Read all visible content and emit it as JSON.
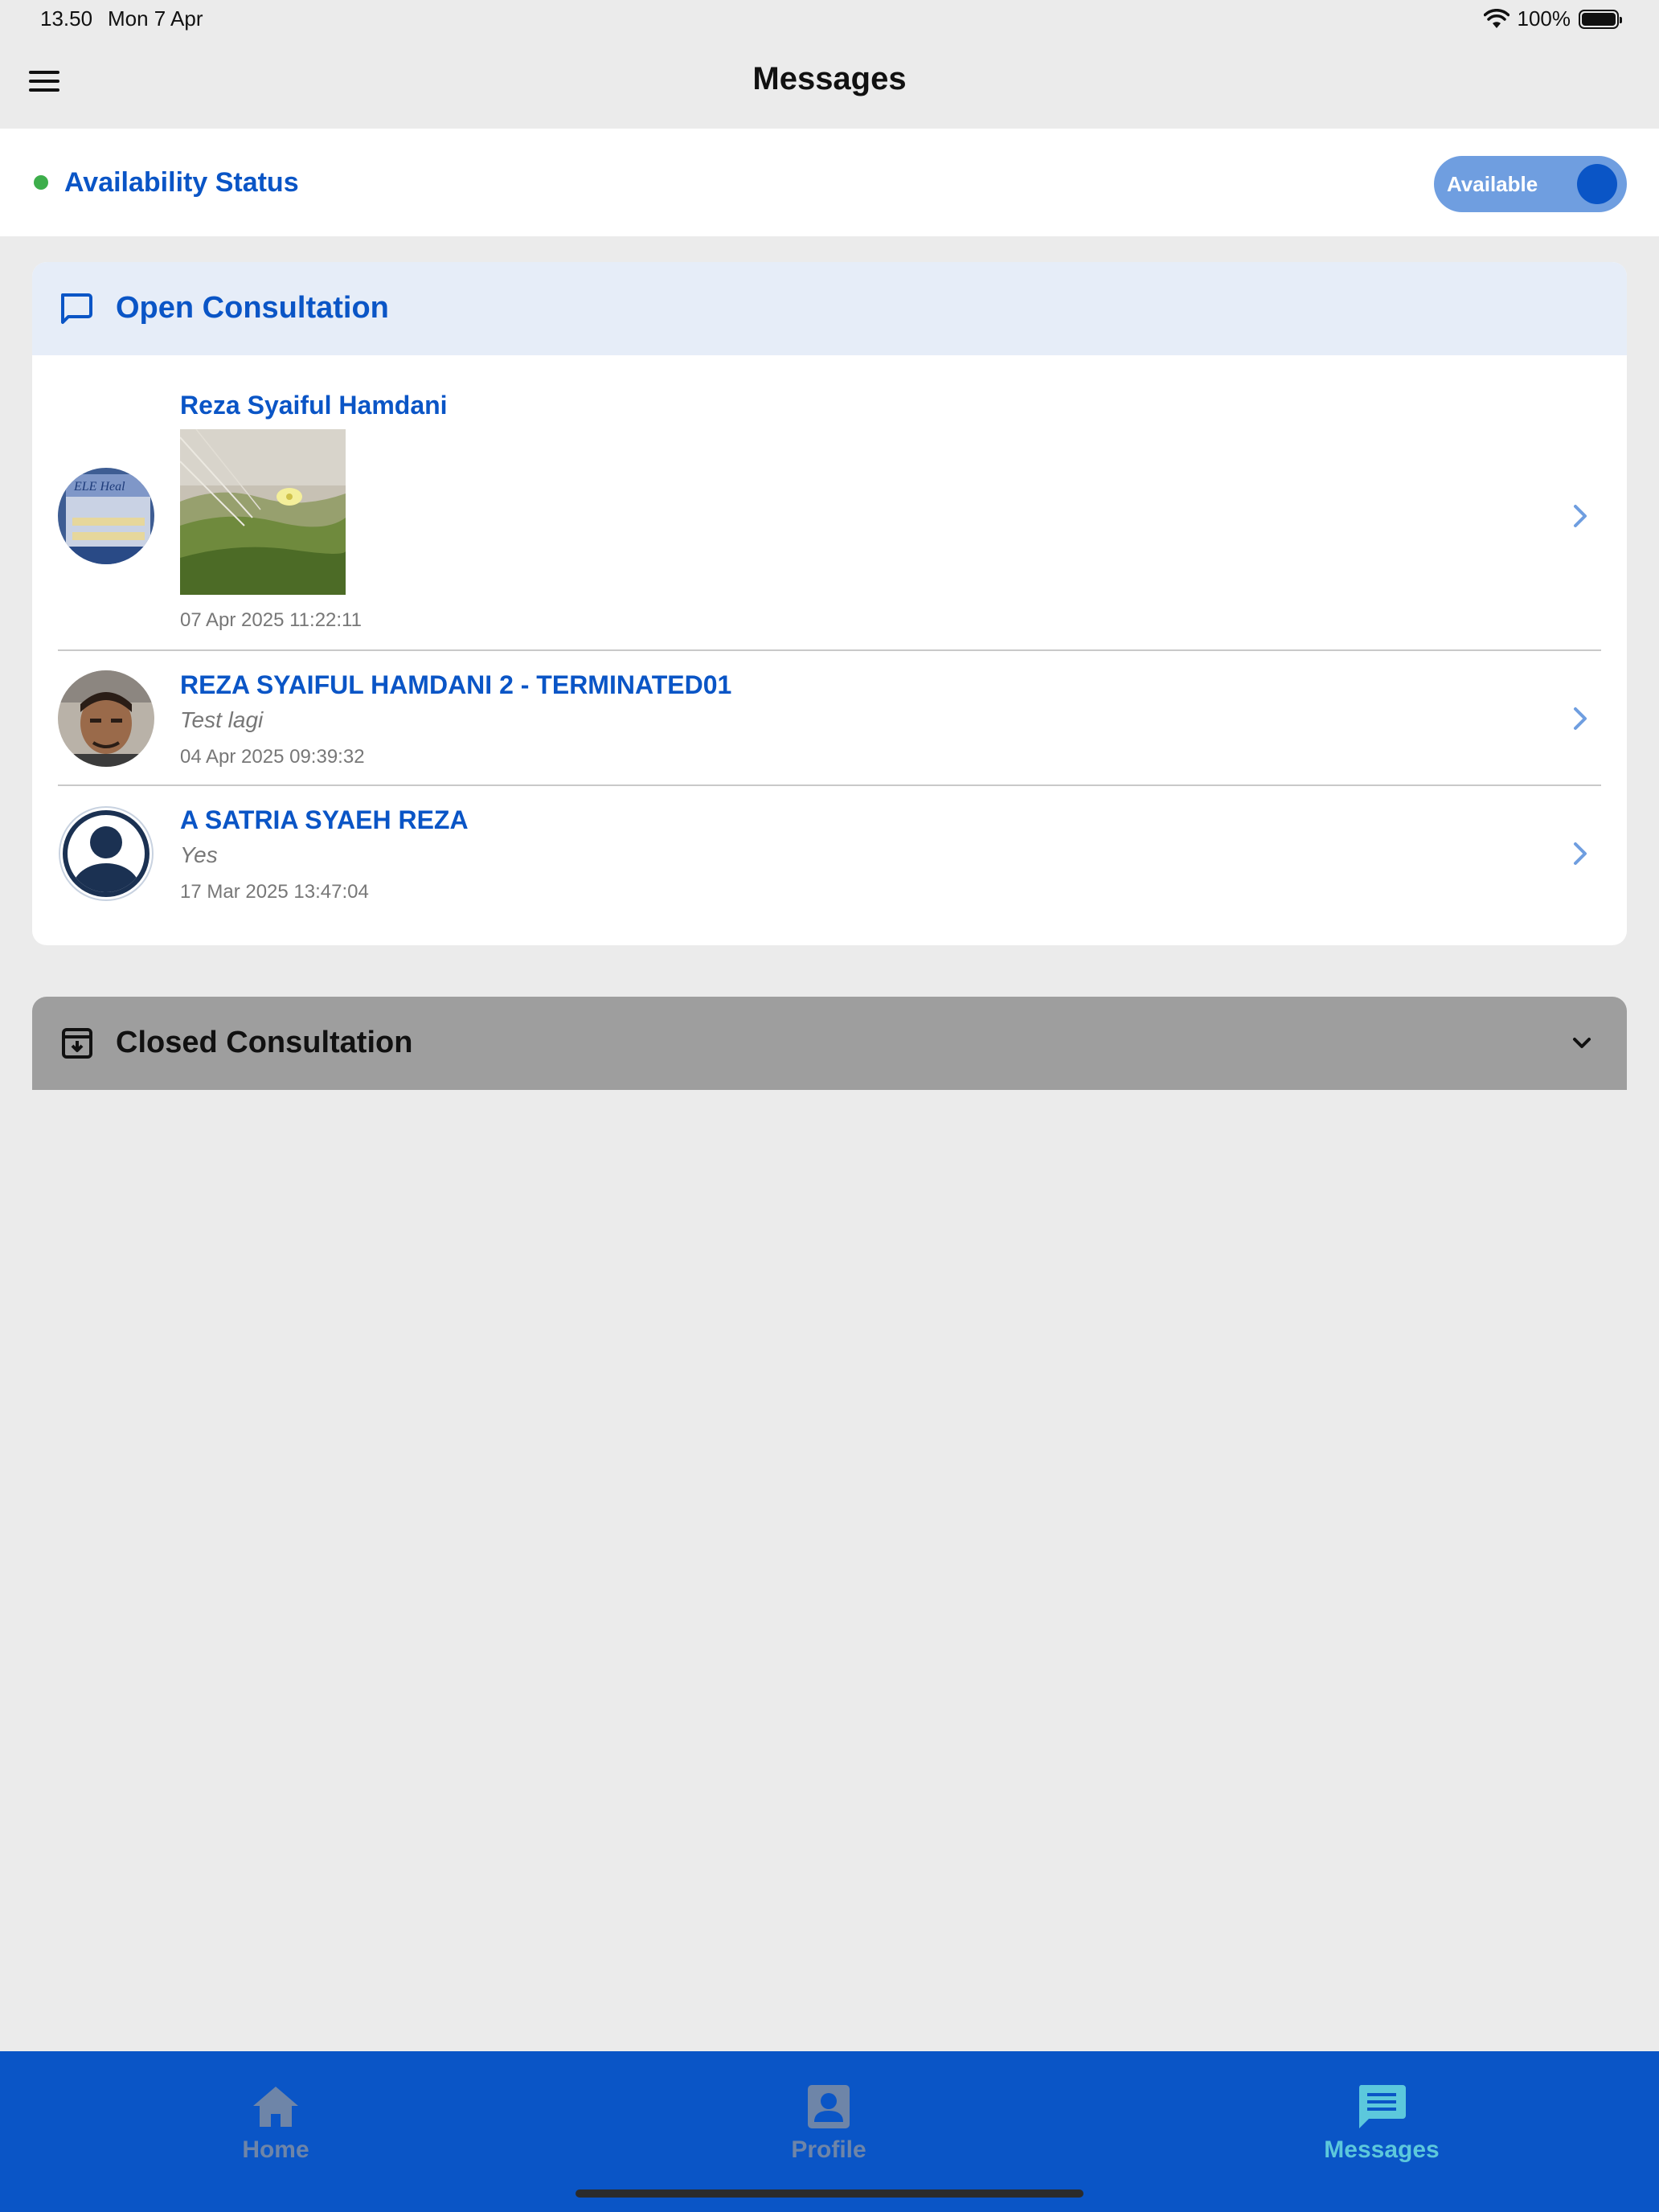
{
  "status_bar": {
    "time": "13.50",
    "date": "Mon 7 Apr",
    "battery": "100%"
  },
  "header": {
    "title": "Messages",
    "menu_icon": "hamburger-menu-icon"
  },
  "availability": {
    "label": "Availability Status",
    "status_color": "#3dae4b",
    "toggle_label": "Available",
    "toggle_on": true
  },
  "open_consultation": {
    "title": "Open Consultation",
    "icon": "chat-bubble-icon",
    "items": [
      {
        "name": "Reza Syaiful Hamdani",
        "preview_type": "image",
        "time": "07 Apr 2025 11:22:11"
      },
      {
        "name": "REZA SYAIFUL HAMDANI 2 - TERMINATED01",
        "preview": "Test lagi",
        "time": "04 Apr 2025 09:39:32"
      },
      {
        "name": "A SATRIA SYAEH REZA",
        "preview": "Yes",
        "time": "17 Mar 2025 13:47:04"
      }
    ]
  },
  "closed_consultation": {
    "title": "Closed Consultation",
    "icon": "archive-icon",
    "expand_icon": "chevron-down-icon"
  },
  "bottom_nav": {
    "items": [
      {
        "label": "Home",
        "icon": "home-icon",
        "active": false
      },
      {
        "label": "Profile",
        "icon": "profile-icon",
        "active": false
      },
      {
        "label": "Messages",
        "icon": "messages-icon",
        "active": true
      }
    ]
  },
  "colors": {
    "primary": "#0a55c6",
    "nav_inactive": "#6e85a8",
    "nav_active": "#5cc8dc",
    "open_header_bg": "#e6edf8",
    "closed_header_bg": "#9e9e9e"
  }
}
